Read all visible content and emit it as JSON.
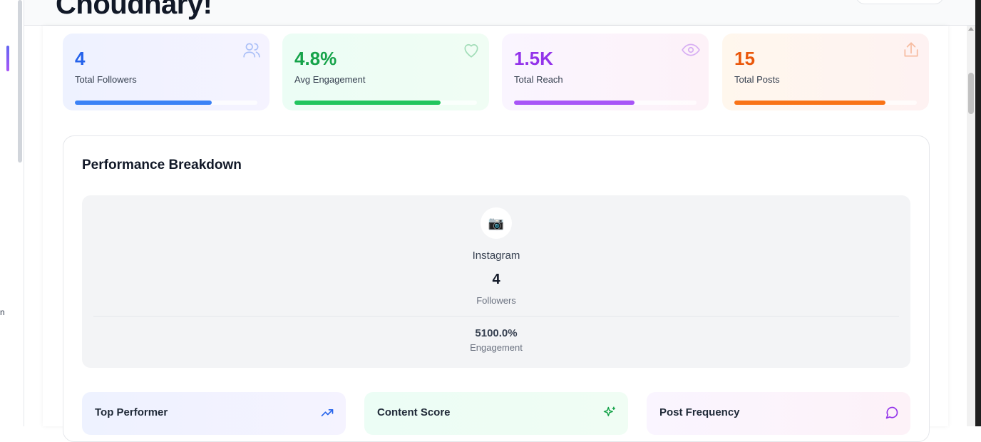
{
  "header": {
    "title": "Choudhary!"
  },
  "sidebar": {
    "clipped_text": "n"
  },
  "stats": [
    {
      "value": "4",
      "label": "Total Followers",
      "color": "#2563eb",
      "bar_color": "#3b82f6",
      "progress": 0.75,
      "icon": "users-icon"
    },
    {
      "value": "4.8%",
      "label": "Avg Engagement",
      "color": "#16a34a",
      "bar_color": "#22c55e",
      "progress": 0.8,
      "icon": "heart-icon"
    },
    {
      "value": "1.5K",
      "label": "Total Reach",
      "color": "#9333ea",
      "bar_color": "#a855f7",
      "progress": 0.66,
      "icon": "eye-icon"
    },
    {
      "value": "15",
      "label": "Total Posts",
      "color": "#ea580c",
      "bar_color": "#f97316",
      "progress": 0.83,
      "icon": "share-icon"
    }
  ],
  "performance": {
    "heading": "Performance Breakdown",
    "platform": {
      "icon": "📷",
      "name": "Instagram",
      "followers": "4",
      "followers_label": "Followers",
      "engagement": "5100.0%",
      "engagement_label": "Engagement"
    }
  },
  "insights": [
    {
      "title": "Top Performer",
      "icon": "trending-up-icon",
      "color": "#2563eb"
    },
    {
      "title": "Content Score",
      "icon": "sparkles-icon",
      "color": "#16a34a"
    },
    {
      "title": "Post Frequency",
      "icon": "message-circle-icon",
      "color": "#9333ea"
    }
  ]
}
